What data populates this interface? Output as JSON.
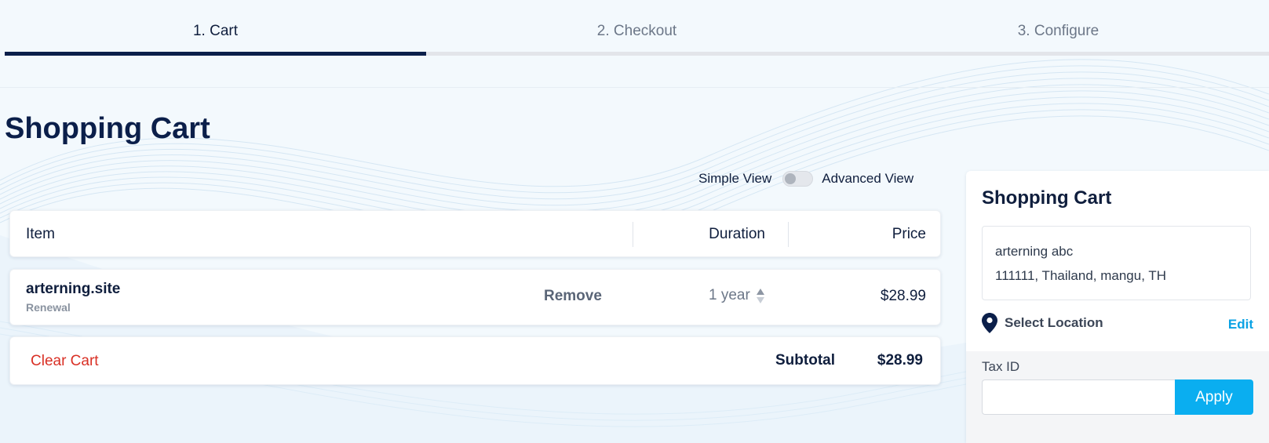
{
  "stepper": {
    "steps": [
      {
        "label": "1. Cart",
        "active": true
      },
      {
        "label": "2. Checkout",
        "active": false
      },
      {
        "label": "3. Configure",
        "active": false
      }
    ]
  },
  "page": {
    "title": "Shopping Cart"
  },
  "view_toggle": {
    "simple_label": "Simple View",
    "advanced_label": "Advanced View",
    "advanced_on": false
  },
  "table": {
    "headers": {
      "item": "Item",
      "duration": "Duration",
      "price": "Price"
    }
  },
  "cart_items": [
    {
      "name": "arterning.site",
      "type": "Renewal",
      "remove_label": "Remove",
      "duration": "1 year",
      "price": "$28.99"
    }
  ],
  "totals": {
    "clear_label": "Clear Cart",
    "subtotal_label": "Subtotal",
    "subtotal_value": "$28.99"
  },
  "summary": {
    "title": "Shopping Cart",
    "address": {
      "name": "arterning abc",
      "line": "111111, Thailand, mangu, TH"
    },
    "location_label": "Select Location",
    "edit_label": "Edit",
    "tax_label": "Tax ID",
    "tax_value": "",
    "apply_label": "Apply"
  },
  "colors": {
    "primary": "#0b1f4a",
    "accent": "#0aaef0",
    "danger": "#d93025",
    "link": "#0aa2e4"
  }
}
